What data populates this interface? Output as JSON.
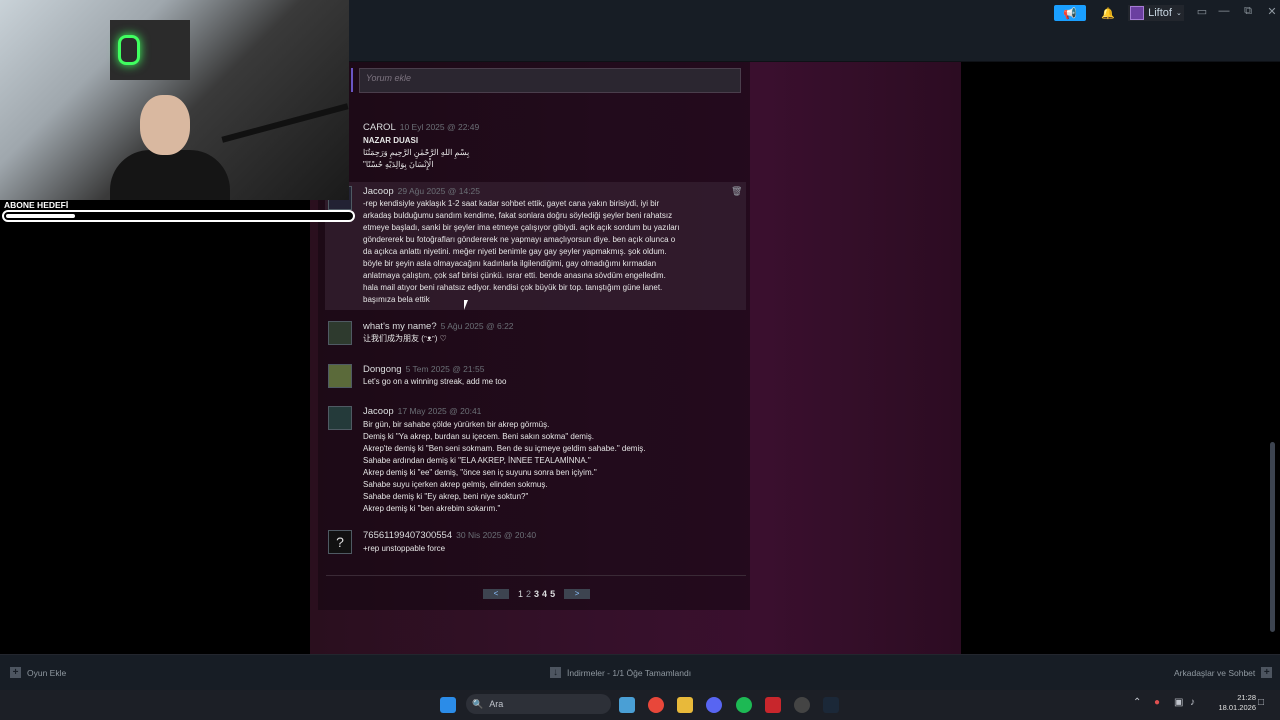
{
  "topbar": {
    "user_name": "Liftof"
  },
  "comment_input": {
    "placeholder": "Yorum ekle"
  },
  "comments": [
    {
      "author": "CAROL",
      "date": "10 Eyl 2025 @ 22:49",
      "lines": [
        "NAZAR DUASI",
        "بِسْمِ اللهِ الرَّحْمٰنِ الرَّحِيمِ وَرَحِمَتُنَا",
        "\"الْإِنْسَانَ بِوَالِدَيْهِ حُسْنًا"
      ]
    },
    {
      "author": "Jacoop",
      "date": "29 Ağu 2025 @ 14:25",
      "lines": [
        "-rep kendisiyle yaklaşık 1-2 saat kadar sohbet ettik, gayet cana yakın birisiydi, iyi bir",
        "arkadaş bulduğumu sandım kendime, fakat sonlara doğru söylediği şeyler beni rahatsız",
        "etmeye başladı, sanki bir şeyler ima etmeye çalışıyor gibiydi. açık açık sordum bu yazıları",
        "göndererek bu fotoğrafları göndererek ne yapmayı amaçlıyorsun diye. ben açık olunca o",
        "da açıkca anlattı niyetini. meğer niyeti benimle gay gay şeyler yapmakmış. şok oldum.",
        "böyle bir şeyin asla olmayacağını kadınlarla ilgilendiğimi, gay olmadığımı kırmadan",
        "anlatmaya çalıştım, çok saf birisi çünkü. ısrar etti. bende anasına sövdüm engelledim.",
        "hala mail atıyor beni rahatsız ediyor. kendisi çok büyük bir top. tanıştığım güne lanet.",
        "başımıza bela ettik"
      ]
    },
    {
      "author": "what's my name?",
      "date": "5 Ağu 2025 @ 6:22",
      "lines": [
        "让我们成为朋友 (ᵔᴥᵔ) ♡"
      ]
    },
    {
      "author": "Dongong",
      "date": "5 Tem 2025 @ 21:55",
      "lines": [
        "Let's go on a winning streak, add me too"
      ]
    },
    {
      "author": "Jacoop",
      "date": "17 May 2025 @ 20:41",
      "lines": [
        "Bir gün, bir sahabe çölde yürürken bir akrep görmüş.",
        "Demiş ki \"Ya akrep, burdan su içecem. Beni sakın sokma\" demiş.",
        "Akrep'te demiş ki \"Ben seni sokmam. Ben de su içmeye geldim sahabe.\" demiş.",
        "Sahabe ardından demiş ki \"ELA AKREP, İNNEE TEALAMİNNA.\"",
        "Akrep demiş ki \"ee\" demiş, \"önce sen iç suyunu sonra ben içiyim.\"",
        "Sahabe suyu içerken akrep gelmiş, elinden sokmuş.",
        "Sahabe demiş ki \"Ey akrep, beni niye soktun?\"",
        "Akrep demiş ki \"ben akrebim sokarım.\""
      ]
    },
    {
      "author": "76561199407300554",
      "date": "30 Nis 2025 @ 20:40",
      "lines": [
        "+rep unstoppable force"
      ]
    }
  ],
  "pager": {
    "prev": "<",
    "next": ">",
    "pages": [
      "1",
      "2",
      "3",
      "4",
      "5"
    ]
  },
  "bottombar": {
    "add_game": "Oyun Ekle",
    "downloads": "İndirmeler - 1/1 Öğe Tamamlandı",
    "friends": "Arkadaşlar ve Sohbet"
  },
  "overlay": {
    "goal_label": "ABONE HEDEFİ",
    "goal_fill": 0.2
  },
  "taskbar": {
    "search": "Ara",
    "time": "21:28",
    "date": "18.01.2026"
  },
  "colors": {
    "accent": "#1a9fff",
    "neon": "#40ff60"
  }
}
